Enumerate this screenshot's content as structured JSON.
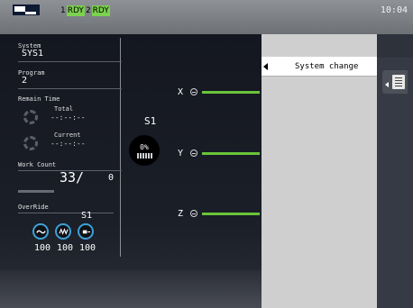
{
  "status": {
    "rdy1_num": "1",
    "rdy1_label": "RDY",
    "rdy2_num": "2",
    "rdy2_label": "RDY",
    "clock": "10:04",
    "rdy_color": "#7bd24f"
  },
  "system": {
    "label": "System",
    "value": "SYS1"
  },
  "program": {
    "label": "Program",
    "value": "2"
  },
  "remain_time": {
    "label": "Remain Time",
    "total_label": "Total",
    "total_value": "--:--:--",
    "current_label": "Current",
    "current_value": "--:--:--"
  },
  "work_count": {
    "label": "Work Count",
    "count": "33/",
    "target": "0"
  },
  "override": {
    "label": "OverRide",
    "system": "S1",
    "items": [
      {
        "icon": "rapid-override-icon",
        "value": "100"
      },
      {
        "icon": "spindle-override-icon",
        "value": "100"
      },
      {
        "icon": "feed-override-icon",
        "value": "100"
      }
    ],
    "accent": "#3ea0d8"
  },
  "spindle": {
    "label": "S1",
    "percent": "0%",
    "icon": "spindle-load-icon"
  },
  "axes": [
    {
      "name": "X",
      "icon": "axis-load-icon"
    },
    {
      "name": "Y",
      "icon": "axis-load-icon"
    },
    {
      "name": "Z",
      "icon": "axis-load-icon"
    }
  ],
  "axis_bar_color": "#6ac43a",
  "menu": {
    "items": [
      {
        "label": "System change",
        "icon": "left-arrow-icon"
      }
    ]
  },
  "side": {
    "icon": "list-icon",
    "arrow_icon": "collapse-arrow-icon"
  }
}
